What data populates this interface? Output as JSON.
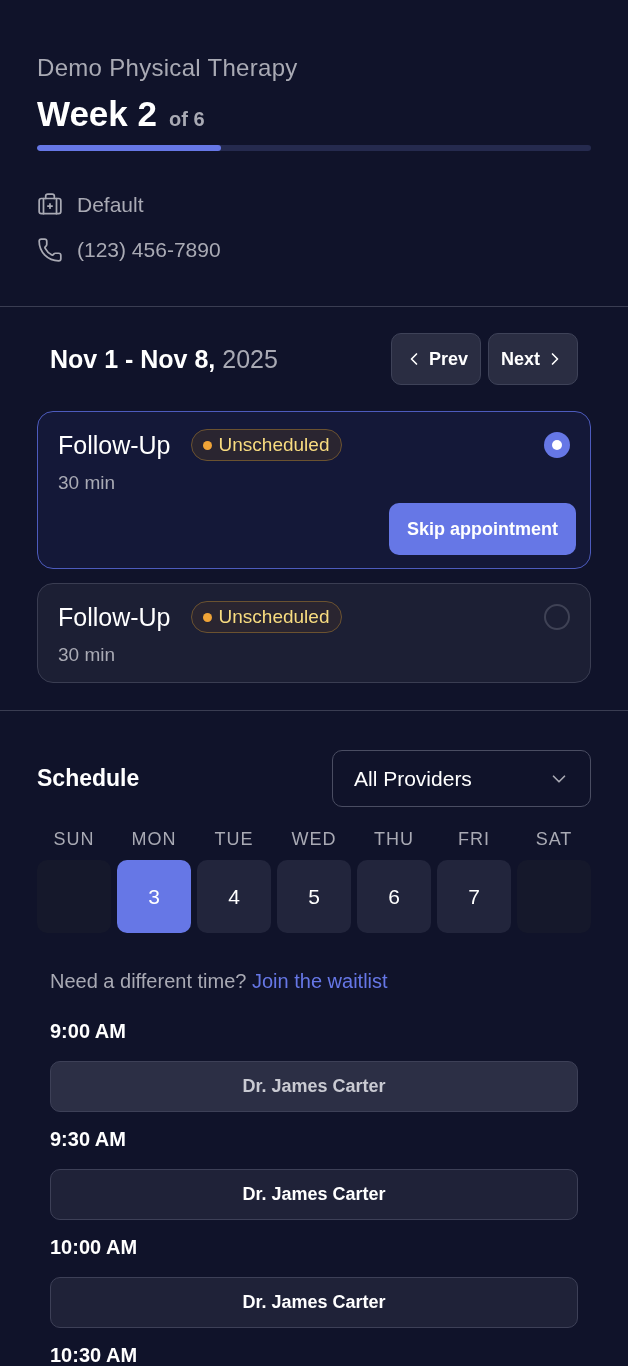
{
  "clinic": {
    "name": "Demo Physical Therapy",
    "week": "Week 2",
    "week_total": "of 6",
    "progress": {
      "level": 0.333
    }
  },
  "details": [
    {
      "kind": "kit",
      "text": "Default"
    },
    {
      "kind": "phone",
      "text": "(123) 456-7890"
    }
  ],
  "week_nav": {
    "date_range": "**Nov 1 - Nov 8,** 2025",
    "prev": "Prev",
    "next": "Next"
  },
  "appointments": [
    {
      "title": "Follow-Up",
      "status": "Unscheduled",
      "duration": "30 min",
      "selected": true,
      "action": "Skip appointment"
    },
    {
      "title": "Follow-Up",
      "status": "Unscheduled",
      "duration": "30 min",
      "selected": false
    }
  ],
  "schedule": {
    "title": "Schedule",
    "provider_select": {
      "value": "All Providers"
    },
    "days": [
      {
        "label": "SUN",
        "disabled": true,
        "selected": false
      },
      {
        "label": "MON",
        "date": "3",
        "disabled": false,
        "selected": true
      },
      {
        "label": "TUE",
        "date": "4",
        "disabled": false,
        "selected": false
      },
      {
        "label": "WED",
        "date": "5",
        "disabled": false,
        "selected": false
      },
      {
        "label": "THU",
        "date": "6",
        "disabled": false,
        "selected": false
      },
      {
        "label": "FRI",
        "date": "7",
        "disabled": false,
        "selected": false
      },
      {
        "label": "SAT",
        "disabled": true,
        "selected": false
      }
    ],
    "waitlist": {
      "prompt": "Need a different time?",
      "link": "Join the waitlist"
    },
    "slots": [
      {
        "time": "9:00 AM",
        "provider": "Dr. James Carter",
        "hovered": true
      },
      {
        "time": "9:30 AM",
        "provider": "Dr. James Carter",
        "hovered": false
      },
      {
        "time": "10:00 AM",
        "provider": "Dr. James Carter",
        "hovered": false
      },
      {
        "time": "10:30 AM"
      }
    ]
  }
}
